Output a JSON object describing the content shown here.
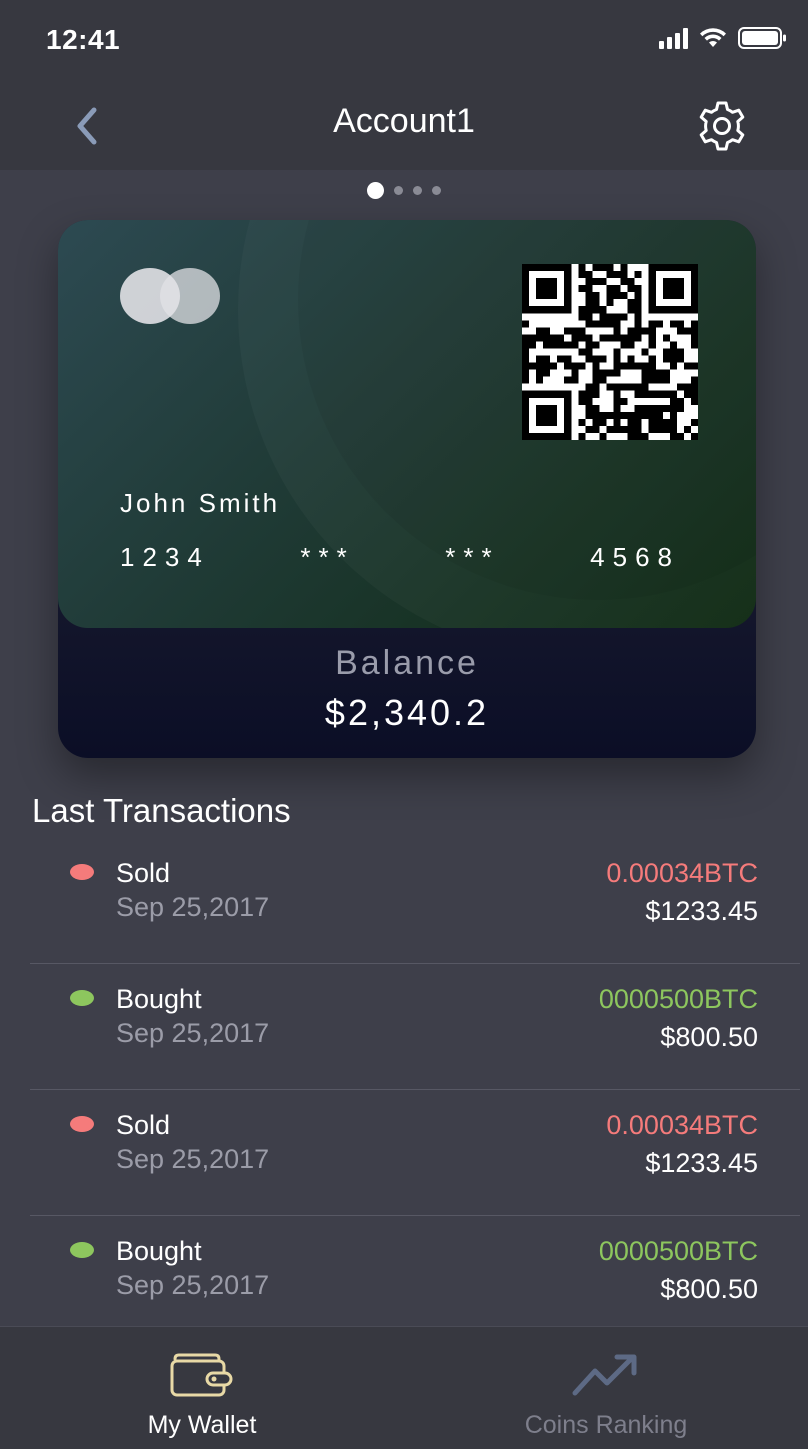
{
  "status_bar": {
    "time": "12:41"
  },
  "nav": {
    "title": "Account1"
  },
  "pager": {
    "count": 4,
    "active_index": 0
  },
  "card": {
    "holder": "John Smith",
    "number_groups": [
      "1234",
      "***",
      "***",
      "4568"
    ],
    "balance_label": "Balance",
    "balance_value": "$2,340.2"
  },
  "transactions": {
    "title": "Last Transactions",
    "items": [
      {
        "type": "Sold",
        "date": "Sep 25,2017",
        "amount": "0.00034BTC",
        "usd": "$1233.45",
        "color": "#f57b7b"
      },
      {
        "type": "Bought",
        "date": "Sep 25,2017",
        "amount": "0000500BTC",
        "usd": "$800.50",
        "color": "#8dc65e"
      },
      {
        "type": "Sold",
        "date": "Sep 25,2017",
        "amount": "0.00034BTC",
        "usd": "$1233.45",
        "color": "#f57b7b"
      },
      {
        "type": "Bought",
        "date": "Sep 25,2017",
        "amount": "0000500BTC",
        "usd": "$800.50",
        "color": "#8dc65e"
      }
    ]
  },
  "tabs": {
    "wallet": {
      "label": "My Wallet",
      "icon": "wallet-icon",
      "color": "#ffffff",
      "icon_color": "#e8d9a6"
    },
    "ranking": {
      "label": "Coins Ranking",
      "icon": "trending-up-icon",
      "color": "#7e7f8c",
      "icon_color": "#5d6a85"
    }
  },
  "colors": {
    "background": "#3e3f4a",
    "bars": "#373840",
    "sold": "#f57b7b",
    "bought": "#8dc65e"
  }
}
